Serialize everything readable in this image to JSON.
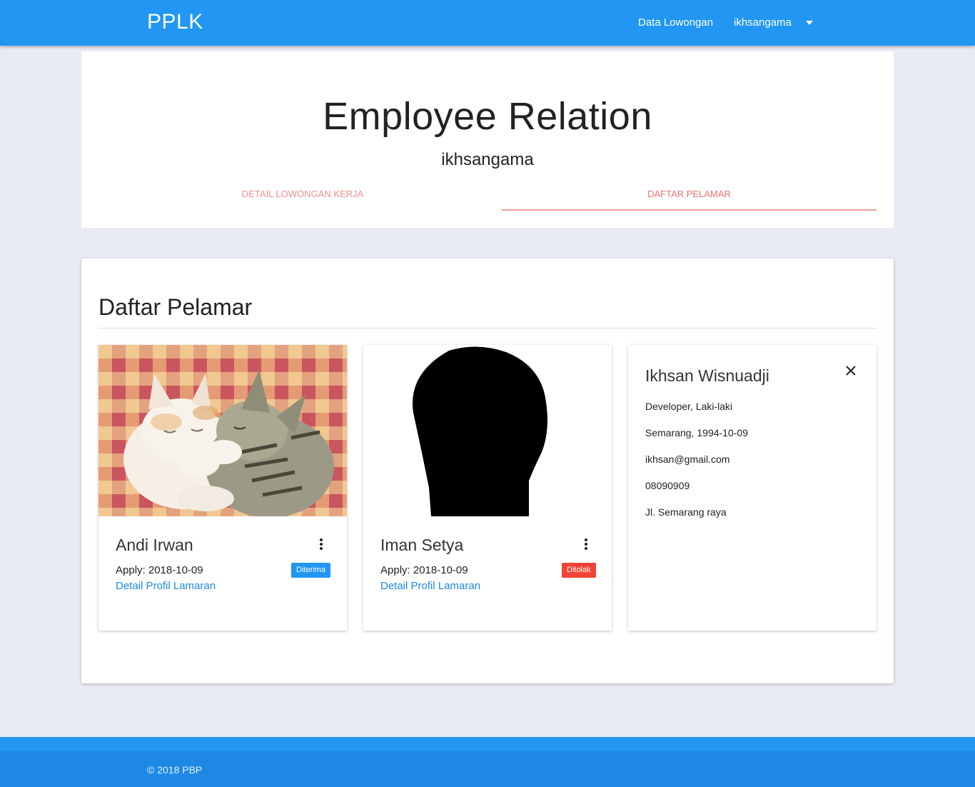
{
  "nav": {
    "brand": "PPLK",
    "links": [
      "Data Lowongan",
      "ikhsangama"
    ]
  },
  "header": {
    "title": "Employee Relation",
    "subtitle": "ikhsangama",
    "tabs": [
      "DETAIL LOWONGAN KERJA",
      "DAFTAR PELAMAR"
    ],
    "active_tab": "DAFTAR PELAMAR"
  },
  "section": {
    "title": "Daftar Pelamar"
  },
  "applicants": [
    {
      "name": "Andi Irwan",
      "apply": "Apply: 2018-10-09",
      "link": "Detail Profil Lamaran",
      "status": "Diterima",
      "status_color": "#2196f3",
      "image": "photo of two kittens cuddling on a checkered blanket"
    },
    {
      "name": "Iman Setya",
      "apply": "Apply: 2018-10-09",
      "link": "Detail Profil Lamaran",
      "status": "Ditolak",
      "status_color": "#f44336",
      "image": "black silhouette placeholder avatar"
    }
  ],
  "reveal": {
    "name": "Ikhsan Wisnuadji",
    "lines": [
      "Developer, Laki-laki",
      "Semarang, 1994-10-09",
      "ikhsan@gmail.com",
      "08090909",
      "Jl. Semarang raya"
    ]
  },
  "footer": {
    "copyright": "© 2018 PBP"
  },
  "colors": {
    "primary": "#2196f3",
    "background": "#e8eaf6",
    "tab_accent": "#e57373",
    "link": "#1e88e5"
  },
  "icons": [
    "caret-down-icon",
    "more-vert-icon",
    "close-icon"
  ]
}
